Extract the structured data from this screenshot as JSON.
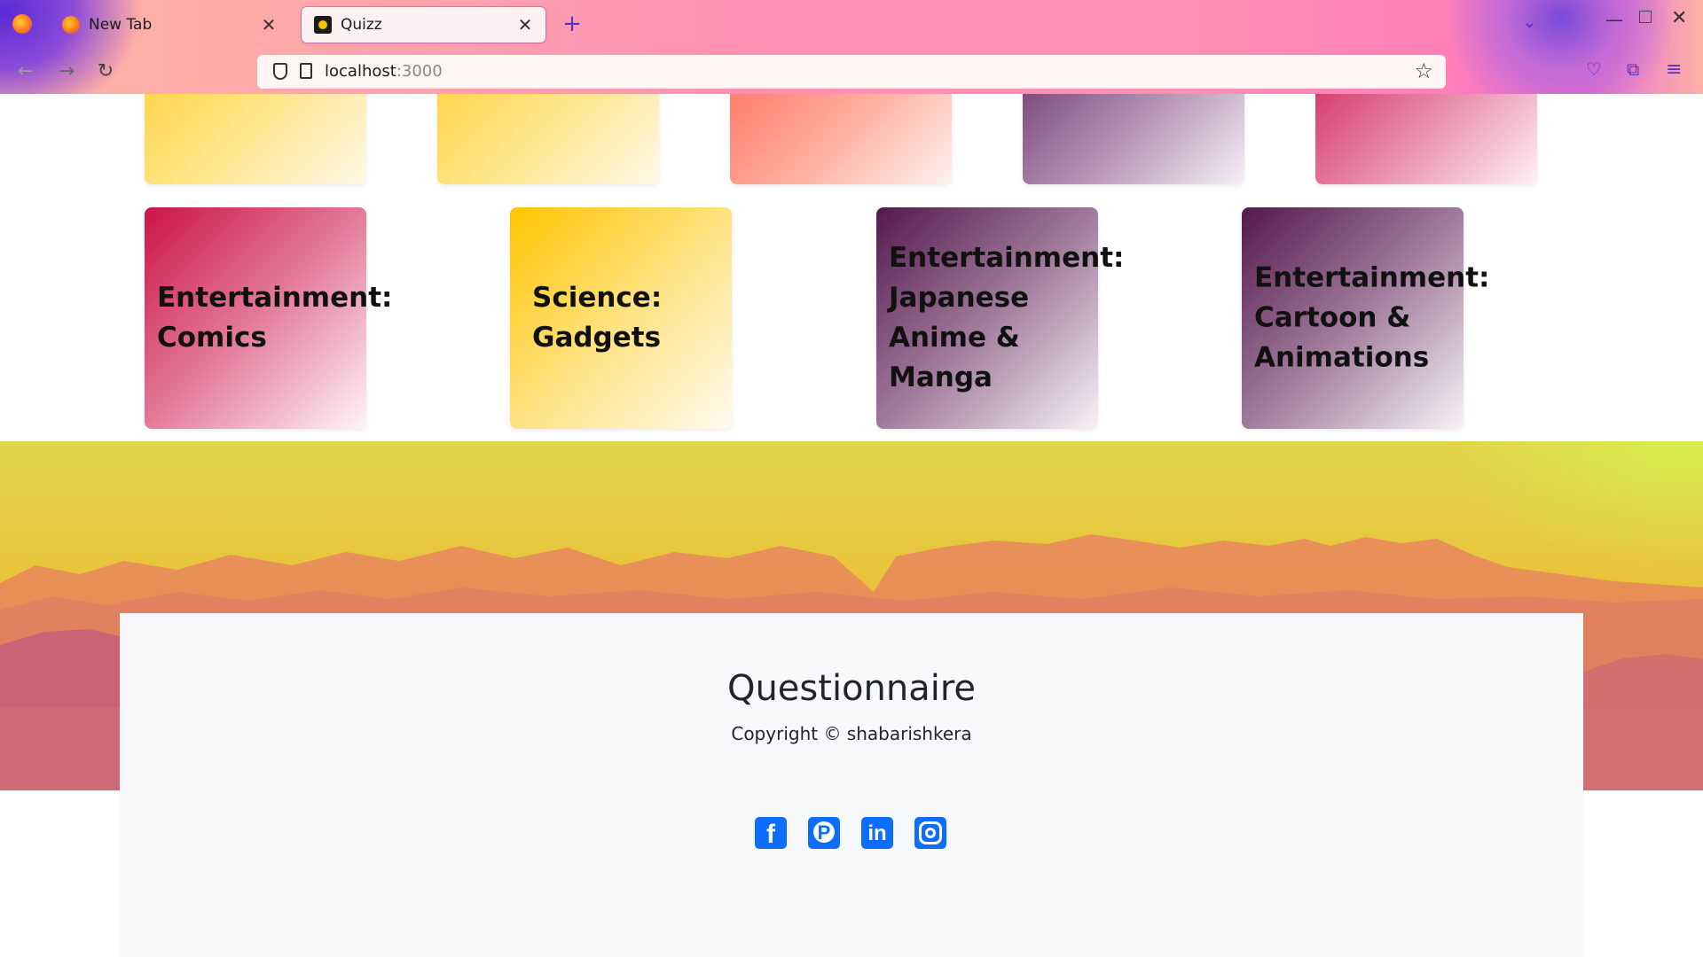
{
  "browser": {
    "tabs": [
      {
        "title": "New Tab",
        "icon": "firefox-icon",
        "active": false
      },
      {
        "title": "Quizz",
        "icon": "quizz-favicon",
        "active": true
      }
    ],
    "url": {
      "host": "localhost",
      "port": ":3000"
    }
  },
  "categories_top": [
    {
      "color": "yellow"
    },
    {
      "color": "yellow"
    },
    {
      "color": "salmon"
    },
    {
      "color": "mauve"
    },
    {
      "color": "pink"
    }
  ],
  "categories": [
    {
      "title": "Entertainment: Comics"
    },
    {
      "title": "Science: Gadgets"
    },
    {
      "title": "Entertainment: Japanese Anime & Manga"
    },
    {
      "title": "Entertainment: Cartoon & Animations"
    }
  ],
  "footer": {
    "title": "Questionnaire",
    "copyright": "Copyright © shabarishkera",
    "social": [
      {
        "name": "facebook",
        "icon": "facebook-icon"
      },
      {
        "name": "pinterest",
        "icon": "pinterest-icon"
      },
      {
        "name": "linkedin",
        "icon": "linkedin-icon"
      },
      {
        "name": "instagram",
        "icon": "instagram-icon"
      }
    ]
  },
  "colors": {
    "accent": "#0d6efd",
    "text": "#212529",
    "footer_bg": "#f7f8fa"
  }
}
